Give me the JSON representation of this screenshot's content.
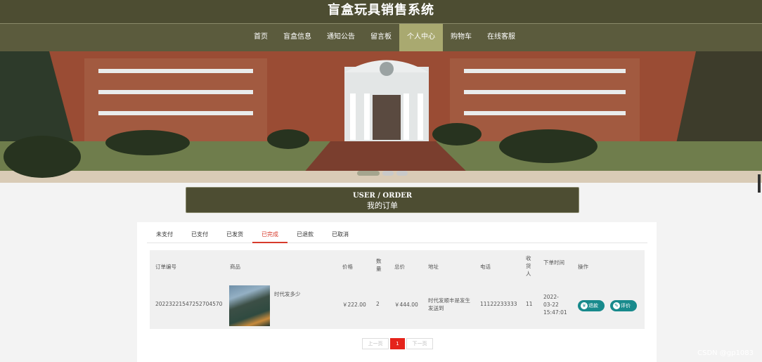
{
  "app": {
    "title": "盲盒玩具销售系统"
  },
  "nav": {
    "items": [
      {
        "label": "首页"
      },
      {
        "label": "盲盒信息"
      },
      {
        "label": "通知公告"
      },
      {
        "label": "留言板"
      },
      {
        "label": "个人中心",
        "active": true
      },
      {
        "label": "购物车"
      },
      {
        "label": "在线客服"
      }
    ]
  },
  "banner": {
    "dots": 3,
    "active_dot": 0
  },
  "section": {
    "en": "USER / ORDER",
    "cn": "我的订单"
  },
  "tabs": [
    {
      "label": "未支付"
    },
    {
      "label": "已支付"
    },
    {
      "label": "已发货"
    },
    {
      "label": "已完成",
      "active": true
    },
    {
      "label": "已退款"
    },
    {
      "label": "已取消"
    }
  ],
  "table": {
    "headers": {
      "order_no": "订单编号",
      "product": "商品",
      "price": "价格",
      "qty": "数量",
      "total": "总价",
      "address": "地址",
      "phone": "电话",
      "receiver": "收货人",
      "time": "下单时间",
      "ops": "操作"
    },
    "rows": [
      {
        "order_no": "20223221547252704570",
        "product_name": "时代发多少",
        "price": "￥222.00",
        "qty": "2",
        "total": "￥444.00",
        "address": "时代发顺丰是发生发送到",
        "phone": "11122233333",
        "receiver": "11",
        "time": "2022-03-22 15:47:01",
        "refund_label": "退款",
        "review_label": "评价"
      }
    ]
  },
  "pager": {
    "prev": "上一页",
    "current": "1",
    "next": "下一页"
  },
  "watermark": "CSDN @gp1083",
  "colors": {
    "header": "#4d4d32",
    "active_nav": "#a9a970",
    "accent": "#d73b2c",
    "action": "#188a8c"
  }
}
